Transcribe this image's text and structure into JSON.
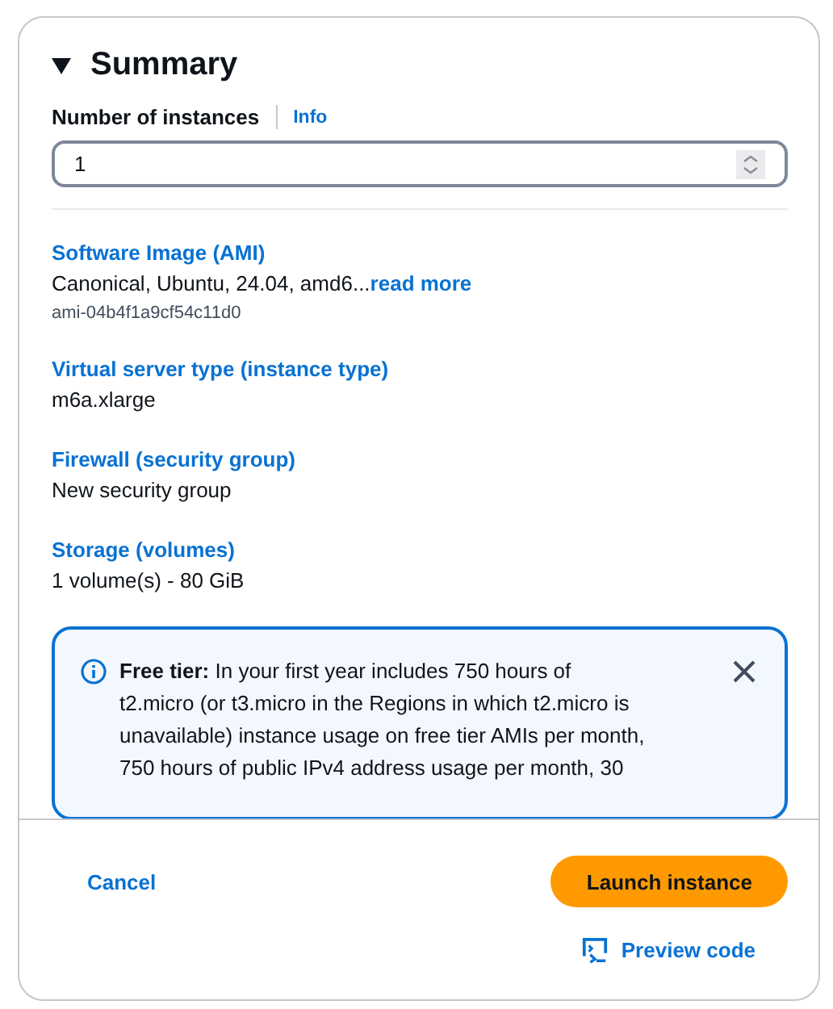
{
  "panel": {
    "title": "Summary",
    "expanded": true
  },
  "instances": {
    "label": "Number of instances",
    "info": "Info",
    "value": "1"
  },
  "details": [
    {
      "label": "Software Image (AMI)",
      "value": "Canonical, Ubuntu, 24.04, amd6...",
      "link": "read more",
      "sub": "ami-04b4f1a9cf54c11d0"
    },
    {
      "label": "Virtual server type (instance type)",
      "value": "m6a.xlarge"
    },
    {
      "label": "Firewall (security group)",
      "value": "New security group"
    },
    {
      "label": "Storage (volumes)",
      "value": "1 volume(s) - 80 GiB"
    }
  ],
  "alert": {
    "lines": [
      "**Free tier:** In your first year includes 750 hours of",
      "t2.micro (or t3.micro in the Regions in which t2.micro is",
      "unavailable) instance usage on free tier AMIs per month,",
      "750 hours of public IPv4 address usage per month, 30"
    ]
  },
  "footer": {
    "cancel": "Cancel",
    "launch": "Launch instance",
    "preview": "Preview code"
  }
}
